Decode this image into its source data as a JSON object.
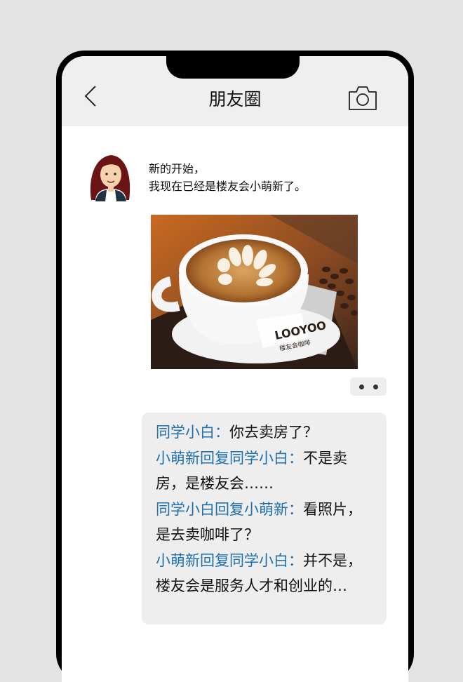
{
  "header": {
    "title": "朋友圈",
    "back_icon": "chevron-left-icon",
    "camera_icon": "camera-icon"
  },
  "post": {
    "text_line1": "新的开始，",
    "text_line2": "我现在已经是楼友会小萌新了。",
    "photo_logo_text": "LOOYOO",
    "photo_subtext": "楼友会咖啡",
    "more_icon": "more-dots-icon"
  },
  "comments": [
    {
      "name": "同学小白",
      "sep": "：",
      "text": "你去卖房了？"
    },
    {
      "name": "小萌新回复同学小白",
      "sep": "：",
      "text": "不是卖房，是楼友会……"
    },
    {
      "name": "同学小白回复小萌新",
      "sep": "：",
      "text": "看照片，是去卖咖啡了？"
    },
    {
      "name": "小萌新回复同学小白",
      "sep": "：",
      "text": "并不是，楼友会是服务人才和创业的…"
    }
  ],
  "colors": {
    "name_blue": "#1e6fb0",
    "header_bg": "#f0eff0",
    "comment_bg": "#eeeeee",
    "page_bg": "#e3e3e3"
  }
}
